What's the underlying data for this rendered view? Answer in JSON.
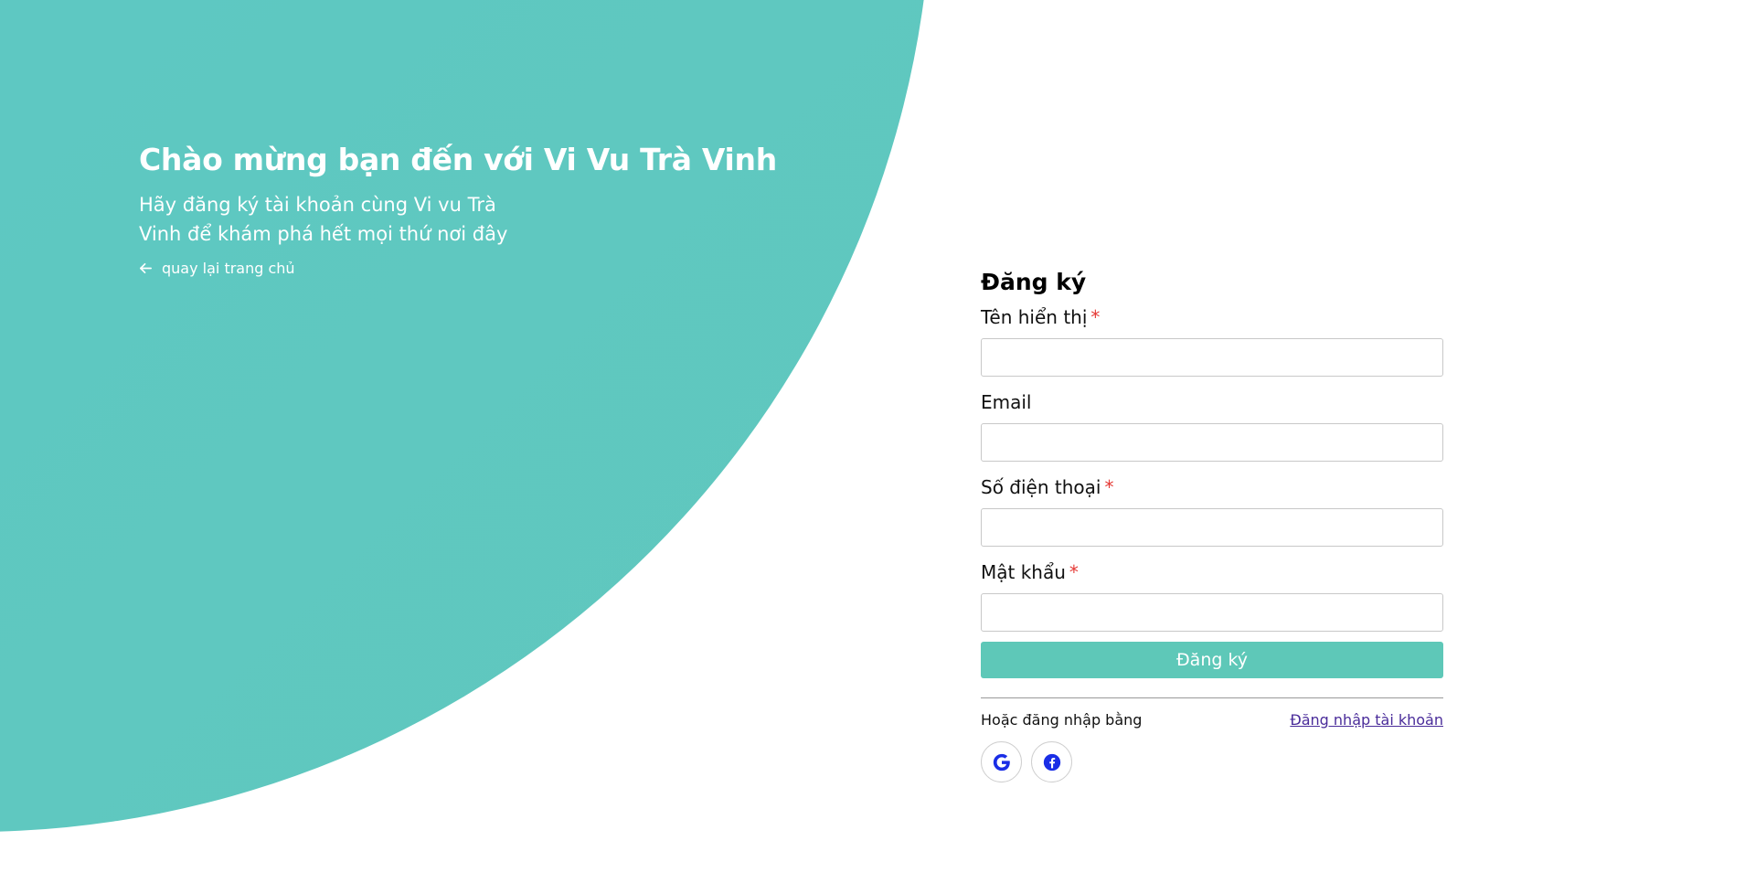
{
  "hero": {
    "title": "Chào mừng bạn đến với Vi Vu Trà Vinh",
    "subtitle": "Hãy đăng ký tài khoản cùng Vi vu Trà Vinh để khám phá hết mọi thứ nơi đây",
    "back_link": "quay lại trang chủ",
    "back_icon": "arrow-left-icon"
  },
  "form": {
    "title": "Đăng ký",
    "fields": [
      {
        "label": "Tên hiển thị",
        "required": true,
        "value": "",
        "placeholder": ""
      },
      {
        "label": "Email",
        "required": false,
        "value": "",
        "placeholder": ""
      },
      {
        "label": "Số điện thoại",
        "required": true,
        "value": "",
        "placeholder": ""
      },
      {
        "label": "Mật khẩu",
        "required": true,
        "value": "",
        "placeholder": ""
      }
    ],
    "required_mark": "*",
    "submit_label": "Đăng ký",
    "alt_label": "Hoặc đăng nhập bằng",
    "login_link": "Đăng nhập tài khoản",
    "social": [
      {
        "icon": "google-icon"
      },
      {
        "icon": "facebook-icon"
      }
    ]
  },
  "colors": {
    "accent": "#5ec8b8",
    "hero_gradient_start": "#5bc3d6",
    "hero_gradient_end": "#60c7bd",
    "required": "#e53935",
    "link": "#4a2c9a",
    "social_icon": "#1a2ee6"
  }
}
